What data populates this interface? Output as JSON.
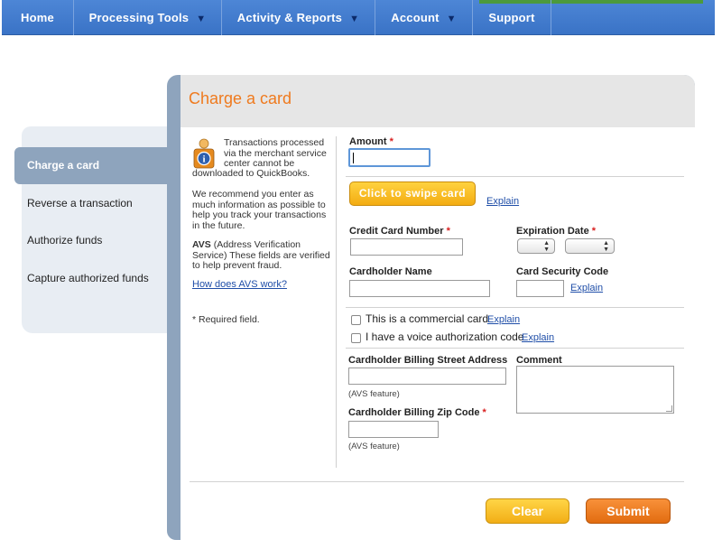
{
  "nav": {
    "items": [
      {
        "label": "Home",
        "arrow": ""
      },
      {
        "label": "Processing Tools",
        "arrow": "▼"
      },
      {
        "label": "Activity & Reports",
        "arrow": "▼"
      },
      {
        "label": "Account",
        "arrow": "▼"
      },
      {
        "label": "Support",
        "arrow": ""
      }
    ]
  },
  "sidebar": {
    "items": [
      {
        "label": "Charge a card",
        "active": true
      },
      {
        "label": "Reverse a transaction"
      },
      {
        "label": "Authorize funds"
      },
      {
        "label": "Capture authorized funds"
      }
    ]
  },
  "panel": {
    "title": "Charge a card"
  },
  "info": {
    "icon": "info-person-icon",
    "text1_lines": [
      "Transactions processed",
      "via the merchant service",
      "center cannot be",
      "downloaded to QuickBooks."
    ],
    "text2_lines": [
      "We recommend you enter as",
      "much information as possible to",
      "help you track your transactions",
      "in the future."
    ],
    "avs_bold": "AVS",
    "avs_lines": [
      " (Address Verification",
      "Service) These fields are verified",
      "to help prevent fraud."
    ],
    "avs_link": "How does AVS work?",
    "required_note": "* Required field."
  },
  "form": {
    "amount_label": "Amount",
    "required_mark": "*",
    "amount_value": "",
    "swipe_button": "Click to swipe card",
    "explain": "Explain",
    "card_number_label": "Credit Card Number",
    "expiration_label": "Expiration Date",
    "cardholder_name_label": "Cardholder Name",
    "security_code_label": "Card Security Code",
    "commercial_label": "This is a commercial card",
    "voice_auth_label": "I have a voice authorization code",
    "street_label": "Cardholder Billing Street Address",
    "comment_label": "Comment",
    "avs_feature": "(AVS feature)",
    "zip_label": "Cardholder Billing Zip Code"
  },
  "buttons": {
    "clear": "Clear",
    "submit": "Submit"
  },
  "colors": {
    "nav_blue": "#3a73c6",
    "title_orange": "#ef7a1e",
    "side_active": "#8ea4bd",
    "link_blue": "#1f4ea8",
    "required_red": "#d81e1e"
  }
}
